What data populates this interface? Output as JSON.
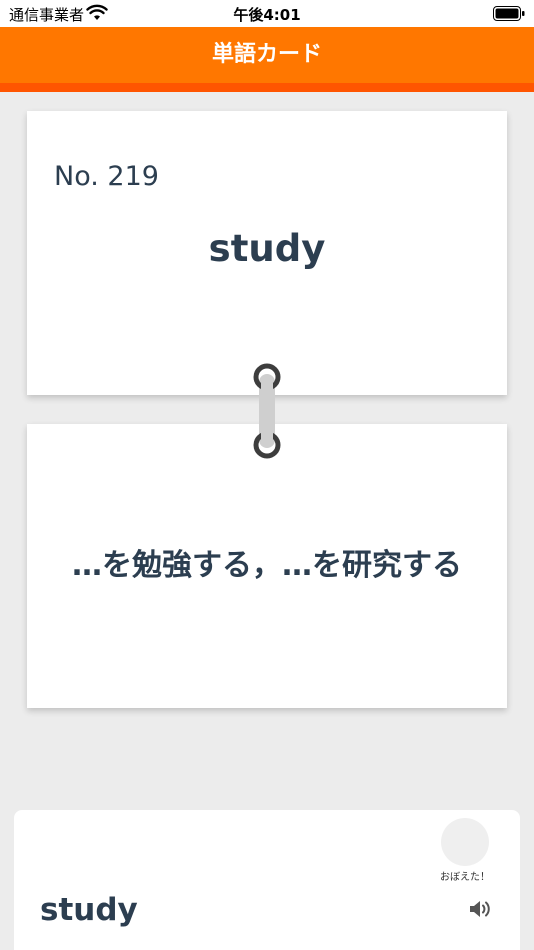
{
  "status_bar": {
    "carrier": "通信事業者",
    "time": "午後4:01"
  },
  "nav": {
    "title": "単語カード"
  },
  "card_front": {
    "number": "No. 219",
    "word": "study"
  },
  "card_back": {
    "meaning": "…を勉強する，…を研究する"
  },
  "bottom_panel": {
    "memorized_label": "おぼえた！",
    "word": "study"
  },
  "colors": {
    "nav_bar": "#ff7700",
    "nav_underline": "#ff5500",
    "text_primary": "#2c3e50",
    "background": "#ececec"
  }
}
